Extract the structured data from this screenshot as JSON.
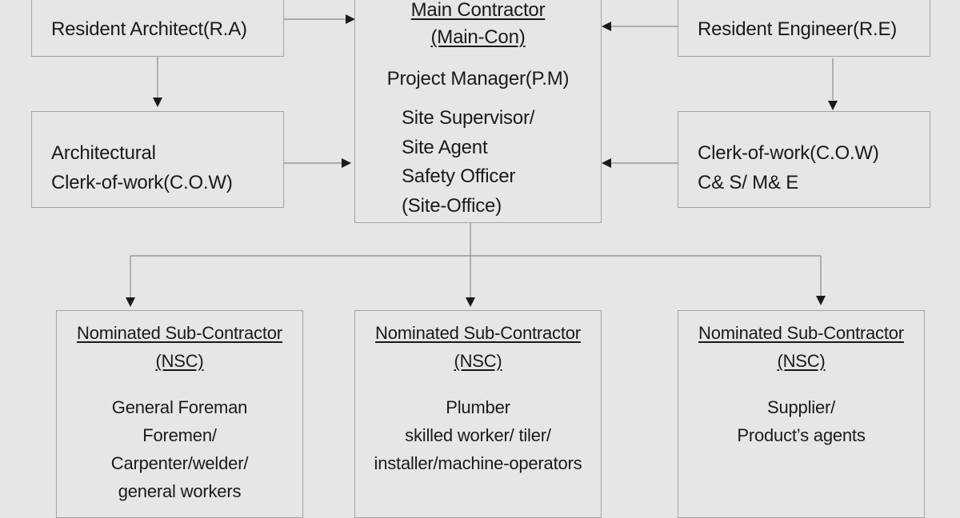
{
  "diagram": {
    "resident_architect": {
      "label": "Resident Architect(R.A)"
    },
    "architectural_cow": {
      "lines": [
        "Architectural",
        "Clerk-of-work(C.O.W)"
      ]
    },
    "main_contractor": {
      "title_lines": [
        "Main Contractor",
        "(Main-Con)"
      ],
      "project_manager": "Project Manager(P.M)",
      "staff_lines": [
        "Site Supervisor/",
        "Site Agent",
        "Safety Officer",
        "(Site-Office)"
      ]
    },
    "resident_engineer": {
      "label": "Resident Engineer(R.E)"
    },
    "engineering_cow": {
      "lines": [
        "Clerk-of-work(C.O.W)",
        "C& S/ M& E"
      ]
    },
    "subcontractors": [
      {
        "title_lines": [
          "Nominated Sub-Contractor",
          "(NSC)"
        ],
        "body_lines": [
          "General Foreman",
          "Foremen/",
          "Carpenter/welder/",
          "general workers"
        ]
      },
      {
        "title_lines": [
          "Nominated Sub-Contractor",
          "(NSC)"
        ],
        "body_lines": [
          "Plumber",
          "skilled worker/ tiler/",
          "installer/machine-operators"
        ]
      },
      {
        "title_lines": [
          "Nominated Sub-Contractor",
          "(NSC)"
        ],
        "body_lines": [
          "Supplier/",
          "Product’s agents"
        ]
      }
    ],
    "colors": {
      "background": "#e6e6e6",
      "box_border": "#a3a3a3",
      "connector": "#8a8a8a",
      "arrowhead": "#1a1a1a",
      "text": "#1a1a1a"
    }
  }
}
